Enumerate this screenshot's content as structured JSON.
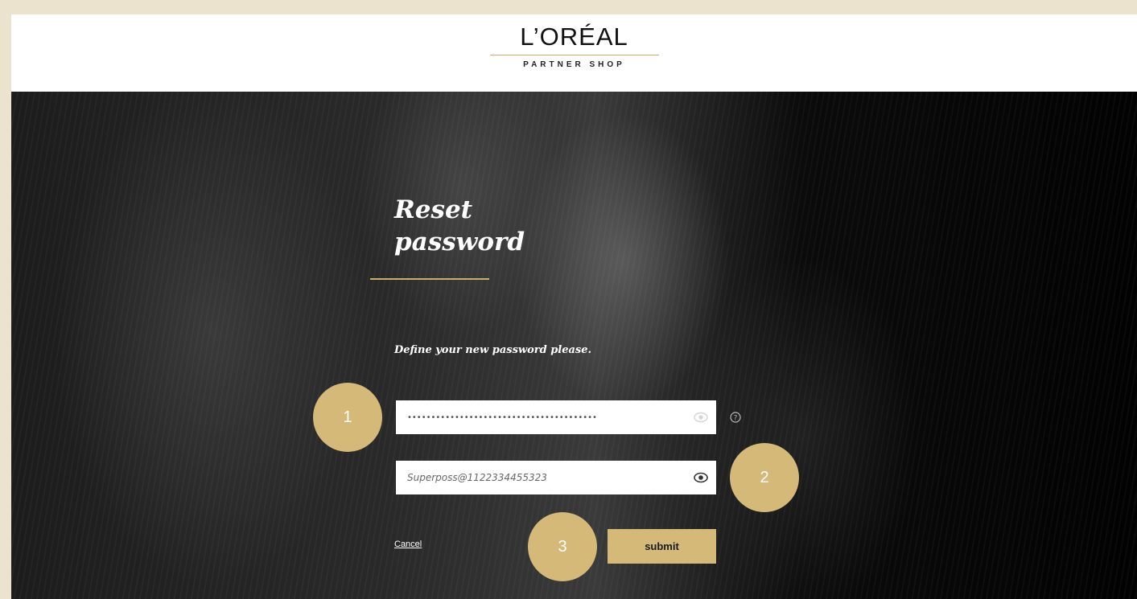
{
  "brand": {
    "logo_text": "L’ORÉAL",
    "logo_subtitle": "PARTNER SHOP",
    "accent_color": "#d4b978"
  },
  "form": {
    "title": "Reset\npassword",
    "subtitle": "Define your new password please.",
    "new_password": {
      "value": "••••••••••••••••••••••••••••••••••••••••",
      "toggle_icon": "eye-icon",
      "help_icon": "question-circle-icon"
    },
    "confirm_password": {
      "value": "Superposs@1122334455323",
      "toggle_icon": "eye-icon"
    },
    "cancel_label": "Cancel",
    "submit_label": "submit"
  },
  "annotations": {
    "badge_1": "1",
    "badge_2": "2",
    "badge_3": "3"
  }
}
